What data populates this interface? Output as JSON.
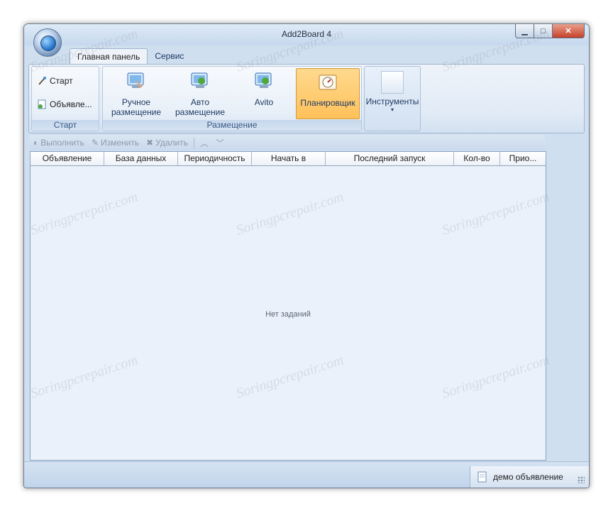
{
  "window": {
    "title": "Add2Board 4"
  },
  "tabs": [
    {
      "label": "Главная панель",
      "active": true
    },
    {
      "label": "Сервис",
      "active": false
    }
  ],
  "ribbon": {
    "start_group": {
      "label": "Старт",
      "buttons": [
        {
          "label": "Старт",
          "icon": "magic-wand-icon"
        },
        {
          "label": "Объявле...",
          "icon": "document-icon"
        }
      ]
    },
    "placement_group": {
      "label": "Размещение",
      "buttons": [
        {
          "label_line1": "Ручное",
          "label_line2": "размещение",
          "icon": "hand-monitor-icon"
        },
        {
          "label_line1": "Авто",
          "label_line2": "размещение",
          "icon": "refresh-monitor-icon"
        },
        {
          "label_line1": "Avito",
          "label_line2": "",
          "icon": "avito-monitor-icon"
        },
        {
          "label_line1": "Планировщик",
          "label_line2": "",
          "icon": "scheduler-icon",
          "selected": true
        }
      ]
    },
    "tools": {
      "label": "Инструменты"
    }
  },
  "toolbar": {
    "run": "Выполнить",
    "edit": "Изменить",
    "delete": "Удалить"
  },
  "table": {
    "columns": [
      "Объявление",
      "База данных",
      "Периодичность",
      "Начать в",
      "Последний запуск",
      "Кол-во",
      "Прио..."
    ],
    "rows": [],
    "empty_text": "Нет заданий"
  },
  "status": {
    "text": "демо объявление"
  },
  "watermark": "Soringpcrepair.com",
  "colors": {
    "selected_button": "#ffc15a",
    "window_bg": "#cfdff0"
  }
}
